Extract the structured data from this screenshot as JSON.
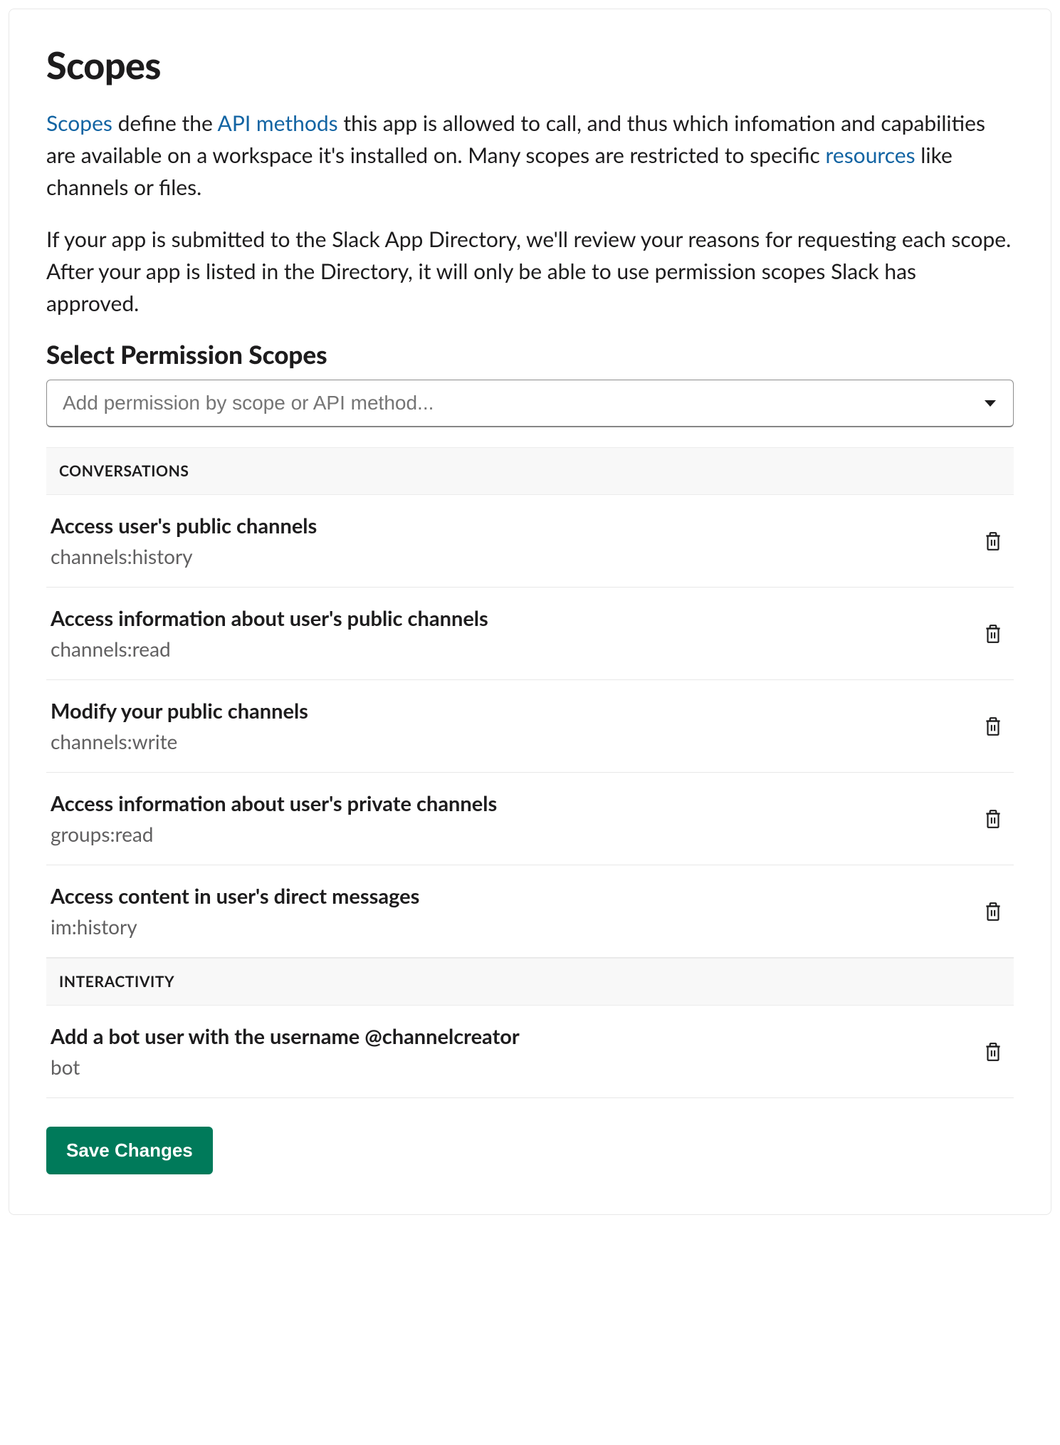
{
  "header": {
    "title": "Scopes",
    "intro_link_scopes": "Scopes",
    "intro_part1": " define the ",
    "intro_link_api": "API methods",
    "intro_part2": " this app is allowed to call, and thus which infomation and capabilities are available on a workspace it's installed on. Many scopes are restricted to specific ",
    "intro_link_resources": "resources",
    "intro_part3": " like channels or files.",
    "para2": "If your app is submitted to the Slack App Directory, we'll review your reasons for requesting each scope. After your app is listed in the Directory, it will only be able to use permission scopes Slack has approved."
  },
  "selector": {
    "heading": "Select Permission Scopes",
    "placeholder": "Add permission by scope or API method..."
  },
  "groups": [
    {
      "label": "CONVERSATIONS",
      "items": [
        {
          "title": "Access user's public channels",
          "key": "channels:history"
        },
        {
          "title": "Access information about user's public channels",
          "key": "channels:read"
        },
        {
          "title": "Modify your public channels",
          "key": "channels:write"
        },
        {
          "title": "Access information about user's private channels",
          "key": "groups:read"
        },
        {
          "title": "Access content in user's direct messages",
          "key": "im:history"
        }
      ]
    },
    {
      "label": "INTERACTIVITY",
      "items": [
        {
          "title": "Add a bot user with the username @channelcreator",
          "key": "bot"
        }
      ]
    }
  ],
  "actions": {
    "save": "Save Changes"
  }
}
